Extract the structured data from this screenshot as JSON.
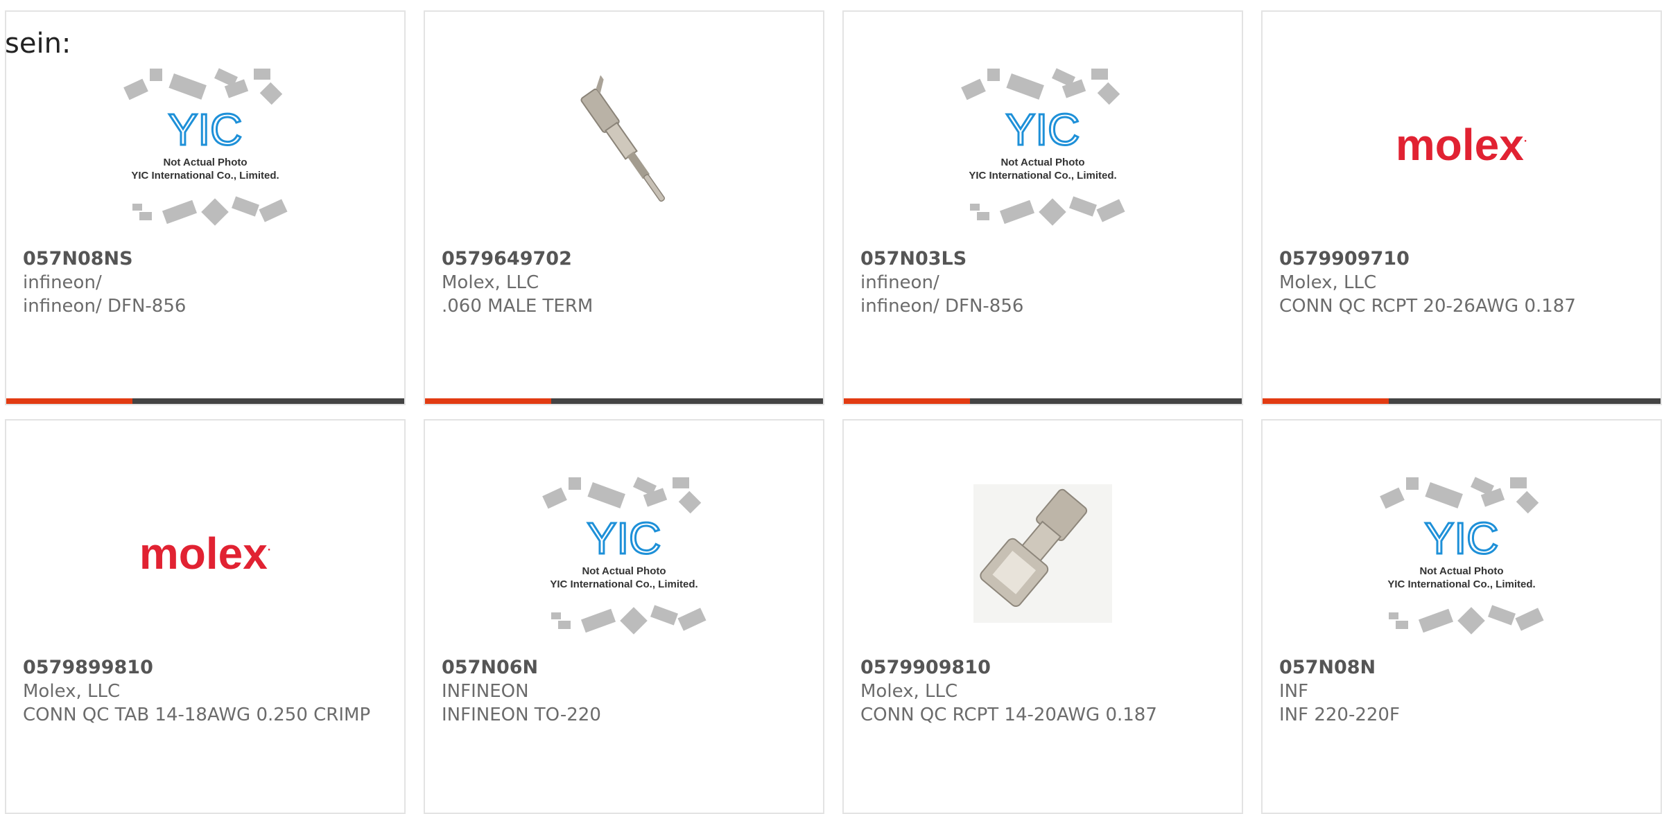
{
  "header_text": "sein:",
  "colors": {
    "accent": "#e23b12",
    "bar": "#444444",
    "molex_red": "#e12232",
    "yic_blue": "#1e90d8"
  },
  "placeholder_image": {
    "line1": "Not Actual Photo",
    "line2": "YIC International Co., Limited.",
    "logo_text": "YIC"
  },
  "molex_logo_text": "molex",
  "products": [
    {
      "part_number": "057N08NS",
      "manufacturer": "infineon/",
      "description": "infineon/ DFN-856",
      "image": "placeholder"
    },
    {
      "part_number": "0579649702",
      "manufacturer": "Molex, LLC",
      "description": ".060 MALE TERM",
      "image": "male-pin"
    },
    {
      "part_number": "057N03LS",
      "manufacturer": "infineon/",
      "description": "infineon/ DFN-856",
      "image": "placeholder"
    },
    {
      "part_number": "0579909710",
      "manufacturer": "Molex, LLC",
      "description": "CONN QC RCPT 20-26AWG 0.187",
      "image": "molex-logo"
    },
    {
      "part_number": "0579899810",
      "manufacturer": "Molex, LLC",
      "description": "CONN QC TAB 14-18AWG 0.250 CRIMP",
      "image": "molex-logo"
    },
    {
      "part_number": "057N06N",
      "manufacturer": "INFINEON",
      "description": "INFINEON TO-220",
      "image": "placeholder"
    },
    {
      "part_number": "0579909810",
      "manufacturer": "Molex, LLC",
      "description": "CONN QC RCPT 14-20AWG 0.187",
      "image": "receptacle"
    },
    {
      "part_number": "057N08N",
      "manufacturer": "INF",
      "description": "INF 220-220F",
      "image": "placeholder"
    }
  ]
}
